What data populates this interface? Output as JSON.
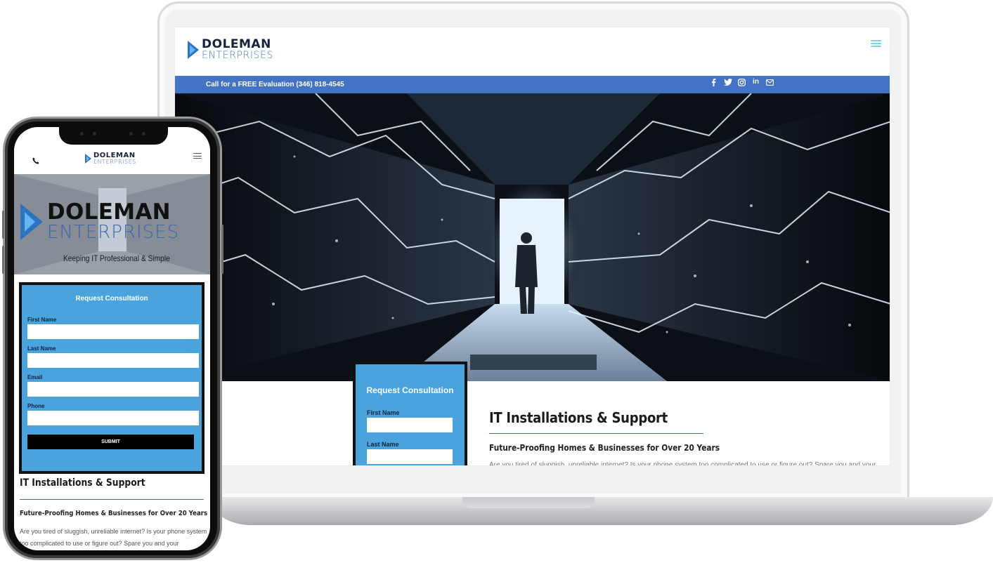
{
  "brand": {
    "name": "DOLEMAN",
    "sub": "ENTERPRISES",
    "tagline": "Keeping IT Professional & Simple"
  },
  "desktop": {
    "topbar_text": "Call for a FREE Evaluation (346) 818-4545",
    "social_icons": [
      "facebook-icon",
      "twitter-icon",
      "instagram-icon",
      "linkedin-icon",
      "email-icon"
    ],
    "linkedin_glyph": "in"
  },
  "form": {
    "title": "Request Consultation",
    "fields": [
      {
        "label": "First Name"
      },
      {
        "label": "Last Name"
      },
      {
        "label": "Email"
      },
      {
        "label": "Phone"
      }
    ],
    "submit_label": "SUBMIT"
  },
  "content": {
    "title": "IT Installations & Support",
    "subtitle": "Future-Proofing Homes & Businesses for Over 20 Years",
    "body": "Are you tired of sluggish, unreliable internet? Is your phone system too complicated to use or figure out? Spare you and your"
  },
  "colors": {
    "topbar": "#4472c4",
    "card": "#4aa3dd",
    "accent": "#2d73c2"
  }
}
